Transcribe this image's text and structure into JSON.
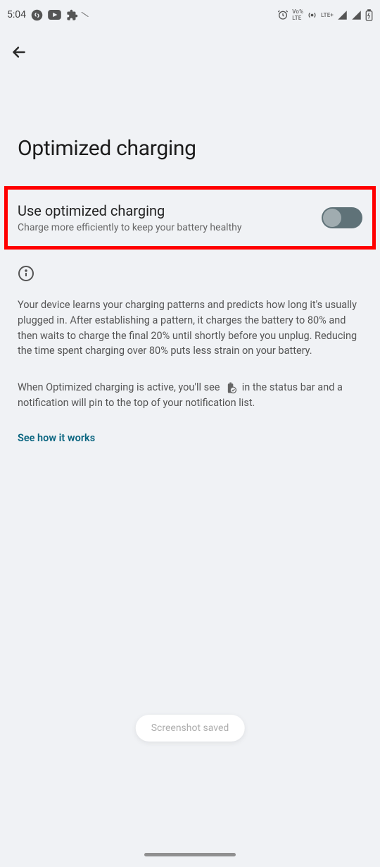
{
  "status": {
    "time": "5:04",
    "volteText": "Vo%\nLTE",
    "lteText": "LTE+"
  },
  "page": {
    "title": "Optimized charging"
  },
  "setting": {
    "title": "Use optimized charging",
    "subtitle": "Charge more efficiently to keep your battery healthy",
    "enabled": false
  },
  "info": {
    "paragraph1": "Your device learns your charging patterns and predicts how long it's usually plugged in. After establishing a pattern, it charges the battery to 80% and then waits to charge the final 20% until shortly before you unplug. Reducing the time spent charging over 80% puts less strain on your battery.",
    "paragraph2_prefix": "When Optimized charging is active, you'll see",
    "paragraph2_suffix": "in the status bar and a notification will pin to the top of your notification list."
  },
  "link": {
    "label": "See how it works"
  },
  "toast": {
    "message": "Screenshot saved"
  }
}
